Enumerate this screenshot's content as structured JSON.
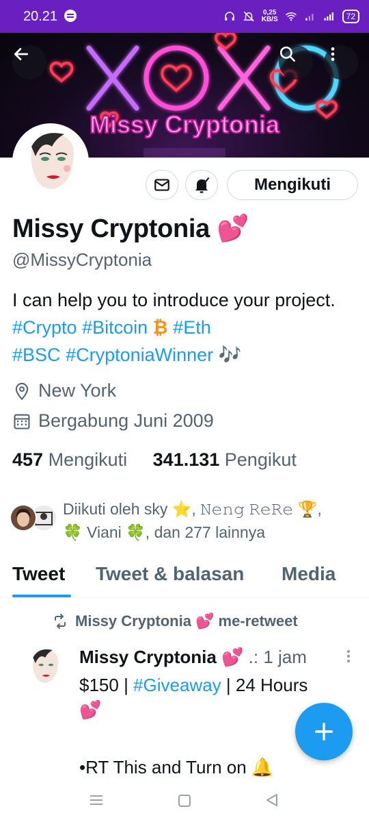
{
  "status_bar": {
    "time": "20.21",
    "speed_value": "0,25",
    "speed_unit": "KB/S",
    "battery": "72",
    "bg_color": "#6a1fc0"
  },
  "banner": {
    "logo_text": "Missy Cryptonia",
    "neon_text": "XOXO"
  },
  "profile": {
    "follow_button": "Mengikuti",
    "name": "Missy Cryptonia 💕",
    "handle": "@MissyCryptonia",
    "bio": {
      "text_1": "I can help you to introduce your project. ",
      "tag_crypto": "#Crypto",
      "tag_bitcoin": "#Bitcoin",
      "bitcoin_emoji": "₿",
      "tag_eth": "#Eth",
      "tag_bsc": "#BSC",
      "tag_winner": "#CryptoniaWinner",
      "music_emoji": "🎶"
    },
    "location": "New York",
    "joined": "Bergabung Juni 2009",
    "following_count": "457",
    "following_label": "Mengikuti",
    "followers_count": "341.131",
    "followers_label": "Pengikut",
    "followed_by_line1": "Diikuti oleh sky ⭐, 𝙽𝚎𝚗𝚐 𝚁𝚎𝚁𝚎 🏆,",
    "followed_by_line2": "🍀 Viani 🍀, dan 277 lainnya"
  },
  "tabs": [
    "Tweet",
    "Tweet & balasan",
    "Media"
  ],
  "tweet": {
    "retweet_label": "Missy Cryptonia 💕 me-retweet",
    "author": "Missy Cryptonia 💕",
    "meta": " .: 1 jam",
    "line1_pre": "$150 | ",
    "line1_tag": "#Giveaway",
    "line1_post": " | 24 Hours",
    "line2": "💕",
    "line3": "•RT This and Turn on 🔔"
  },
  "colors": {
    "accent": "#1d9bf0",
    "secondary_text": "#536471"
  }
}
